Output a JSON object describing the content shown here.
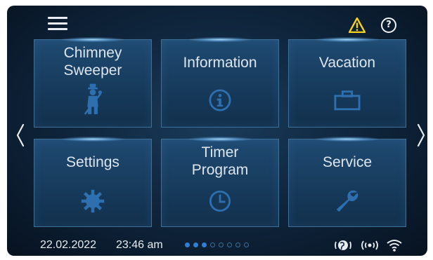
{
  "header": {
    "menu_icon": "hamburger-menu-icon",
    "warning_icon": "warning-triangle-icon",
    "warning_color": "#f6d21c",
    "help_icon": "help-circle-icon",
    "help_glyph": "?"
  },
  "navigation": {
    "left_arrow_icon": "chevron-left-icon",
    "right_arrow_icon": "chevron-right-icon"
  },
  "tiles": [
    {
      "label": "Chimney\nSweeper",
      "icon": "chimney-sweeper-icon"
    },
    {
      "label": "Information",
      "icon": "info-icon"
    },
    {
      "label": "Vacation",
      "icon": "suitcase-icon"
    },
    {
      "label": "Settings",
      "icon": "gear-icon"
    },
    {
      "label": "Timer\nProgram",
      "icon": "clock-icon"
    },
    {
      "label": "Service",
      "icon": "wrench-icon"
    }
  ],
  "status": {
    "date": "22.02.2022",
    "time": "23:46 am",
    "page_dots": {
      "active": 3,
      "total": 8
    },
    "icons": [
      "internet-icon",
      "wireless-signal-icon",
      "wifi-icon"
    ]
  },
  "colors": {
    "tile_background": "#1b4266",
    "tile_border": "#3f6e96",
    "icon_color": "#2e6fb0",
    "text_color": "#dde6ef",
    "accent_blue": "#2f7fd9"
  }
}
